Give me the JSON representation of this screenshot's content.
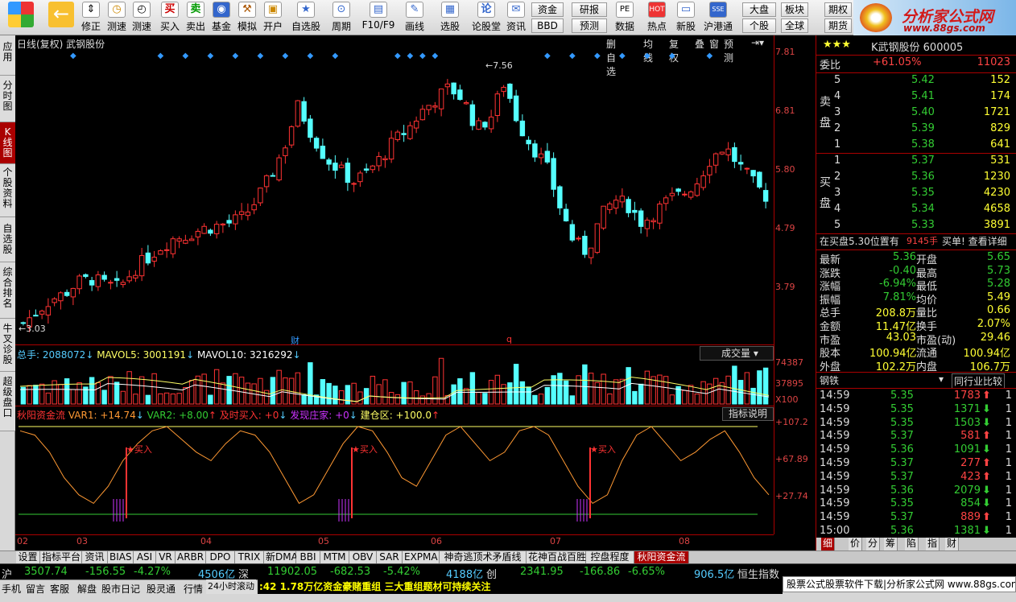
{
  "toolbar": {
    "buttons": [
      {
        "label": "",
        "icon": "windows-flag-icon"
      },
      {
        "label": "",
        "icon": "back-arrow-icon"
      },
      {
        "label": "修正",
        "icon": "up-down-icon"
      },
      {
        "label": "测速",
        "icon": "clock-icon"
      },
      {
        "label": "买入",
        "icon": "buy-icon"
      },
      {
        "label": "卖出",
        "icon": "sell-icon"
      },
      {
        "label": "基金",
        "icon": "fund-icon"
      },
      {
        "label": "模拟",
        "icon": "hammer-icon"
      },
      {
        "label": "开户",
        "icon": "lock-icon"
      },
      {
        "label": "自选股",
        "icon": "star-icon"
      },
      {
        "label": "周期",
        "icon": "period-icon"
      },
      {
        "label": "F10/F9",
        "icon": "f10-icon"
      },
      {
        "label": "画线",
        "icon": "pencil-icon"
      },
      {
        "label": "选股",
        "icon": "select-stock-icon"
      },
      {
        "label": "论股堂",
        "icon": "forum-icon"
      },
      {
        "label": "资讯",
        "icon": "news-icon"
      }
    ],
    "small_buttons": [
      "资金",
      "BBD",
      "研报",
      "预测",
      "数据",
      "热点",
      "新股",
      "沪港通",
      "大盘",
      "板块",
      "期权",
      "个股",
      "全球",
      "期货"
    ],
    "logo_title": "分析家公式网",
    "logo_url": "www.88gs.com"
  },
  "left_tabs": [
    {
      "label": "应用",
      "active": false
    },
    {
      "label": "分时图",
      "active": false
    },
    {
      "label": "K线图",
      "active": true
    },
    {
      "label": "个股资料",
      "active": false
    },
    {
      "label": "自选股",
      "active": false
    },
    {
      "label": "综合排名",
      "active": false
    },
    {
      "label": "牛叉诊股",
      "active": false
    },
    {
      "label": "超级盘口",
      "active": false
    }
  ],
  "chart_header": {
    "title": "日线(复权) 武钢股份",
    "right_buttons": [
      "删自选",
      "均线",
      "复权",
      "叠",
      "窗",
      "预测"
    ],
    "price_max_label": "←7.56",
    "price_min_label": "←3.03",
    "event_labels": [
      "财",
      "q"
    ]
  },
  "chart_data": [
    {
      "type": "candlestick",
      "title": "日线(复权) 武钢股份",
      "y_ticks": [
        "7.81",
        "6.81",
        "5.80",
        "4.79",
        "3.79"
      ],
      "ylim": [
        3.03,
        7.81
      ],
      "x_ticks": [
        "02",
        "03",
        "04",
        "05",
        "06",
        "07",
        "08"
      ],
      "high": 7.56,
      "low": 3.03
    },
    {
      "type": "bar",
      "title": "成交量",
      "legend": [
        {
          "name": "总手",
          "value": "2088072"
        },
        {
          "name": "MAVOL5",
          "value": "3001191"
        },
        {
          "name": "MAVOL10",
          "value": "3216292"
        }
      ],
      "y_ticks": [
        "74387",
        "37895"
      ],
      "unit": "X100"
    },
    {
      "type": "line",
      "title": "秋阳资金流",
      "legend": [
        {
          "name": "VAR1",
          "value": "+14.74"
        },
        {
          "name": "VAR2",
          "value": "+8.00"
        },
        {
          "name": "及时买入",
          "value": "+0"
        },
        {
          "name": "发现庄家",
          "value": "+0"
        },
        {
          "name": "建仓区",
          "value": "+100.0"
        }
      ],
      "y_ticks": [
        "+107.2",
        "+67.89",
        "+27.74"
      ],
      "annotations": [
        "★买入",
        "★买入",
        "★买入"
      ]
    }
  ],
  "indicator_button": "指标说明",
  "volume_button": "成交量",
  "quote": {
    "stars": "★★★",
    "name": "K武钢股份 600005",
    "weibi_label": "委比",
    "weibi_pct": "+61.05%",
    "weibi_val": "11023",
    "sell_label": "卖盘",
    "buy_label": "买盘",
    "sell": [
      {
        "lvl": "5",
        "price": "5.42",
        "vol": "152"
      },
      {
        "lvl": "4",
        "price": "5.41",
        "vol": "174"
      },
      {
        "lvl": "3",
        "price": "5.40",
        "vol": "1721"
      },
      {
        "lvl": "2",
        "price": "5.39",
        "vol": "829"
      },
      {
        "lvl": "1",
        "price": "5.38",
        "vol": "641"
      }
    ],
    "buy": [
      {
        "lvl": "1",
        "price": "5.37",
        "vol": "531"
      },
      {
        "lvl": "2",
        "price": "5.36",
        "vol": "1230"
      },
      {
        "lvl": "3",
        "price": "5.35",
        "vol": "4230"
      },
      {
        "lvl": "4",
        "price": "5.34",
        "vol": "4658"
      },
      {
        "lvl": "5",
        "price": "5.33",
        "vol": "3891"
      }
    ],
    "pos_note": "在买盘5.30位置有",
    "pos_vol": "9145手",
    "pos_action": "买单! 查看详细",
    "stats": [
      {
        "l1": "最新",
        "v1": "5.36",
        "l2": "开盘",
        "v2": "5.65"
      },
      {
        "l1": "涨跌",
        "v1": "-0.40",
        "l2": "最高",
        "v2": "5.73"
      },
      {
        "l1": "涨幅",
        "v1": "-6.94%",
        "l2": "最低",
        "v2": "5.28"
      },
      {
        "l1": "振幅",
        "v1": "7.81%",
        "l2": "均价",
        "v2": "5.49"
      },
      {
        "l1": "总手",
        "v1": "208.8万",
        "l2": "量比",
        "v2": "0.66"
      },
      {
        "l1": "金额",
        "v1": "11.47亿",
        "l2": "换手",
        "v2": "2.07%"
      },
      {
        "l1": "市盈",
        "v1": "43.03",
        "l2": "市盈(动)",
        "v2": "29.46"
      },
      {
        "l1": "股本",
        "v1": "100.94亿",
        "l2": "流通",
        "v2": "100.94亿"
      },
      {
        "l1": "外盘",
        "v1": "102.2万",
        "l2": "内盘",
        "v2": "106.7万"
      }
    ],
    "industry": "钢铁",
    "peer_compare": "同行业比较",
    "ticks": [
      {
        "t": "14:59",
        "p": "5.35",
        "v": "1783",
        "d": "up",
        "n": "1"
      },
      {
        "t": "14:59",
        "p": "5.35",
        "v": "1371",
        "d": "down",
        "n": "1"
      },
      {
        "t": "14:59",
        "p": "5.35",
        "v": "1503",
        "d": "down",
        "n": "1"
      },
      {
        "t": "14:59",
        "p": "5.37",
        "v": "581",
        "d": "up",
        "n": "1"
      },
      {
        "t": "14:59",
        "p": "5.36",
        "v": "1091",
        "d": "down",
        "n": "1"
      },
      {
        "t": "14:59",
        "p": "5.37",
        "v": "277",
        "d": "up",
        "n": "1"
      },
      {
        "t": "14:59",
        "p": "5.37",
        "v": "423",
        "d": "up",
        "n": "1"
      },
      {
        "t": "14:59",
        "p": "5.36",
        "v": "2079",
        "d": "down",
        "n": "1"
      },
      {
        "t": "14:59",
        "p": "5.35",
        "v": "854",
        "d": "down",
        "n": "1"
      },
      {
        "t": "14:59",
        "p": "5.37",
        "v": "889",
        "d": "up",
        "n": "1"
      },
      {
        "t": "15:00",
        "p": "5.36",
        "v": "1381",
        "d": "down",
        "n": "1"
      }
    ],
    "bottom_tabs": [
      "细",
      "价",
      "分",
      "筹",
      "陷",
      "指",
      "财"
    ]
  },
  "bottom_tabs": [
    "设置",
    "指标平台",
    "资讯",
    "BIAS",
    "ASI",
    "VR",
    "ARBR",
    "DPO",
    "TRIX",
    "新DMA",
    "BBI",
    "MTM",
    "OBV",
    "SAR",
    "EXPMA",
    "神奇逃顶术矛盾线",
    "花神百战百胜",
    "控盘程度",
    "秋阳资金流"
  ],
  "status1": {
    "sh_label": "沪",
    "sh_index": "3507.74",
    "sh_chg": "-156.55",
    "sh_pct": "-4.27%",
    "sh_amt": "4506亿",
    "sz_label": "深",
    "sz_index": "11902.05",
    "sz_chg": "-682.53",
    "sz_pct": "-5.42%",
    "sz_amt": "4188亿",
    "cy_label": "创",
    "cy_index": "2341.95",
    "cy_chg": "-166.86",
    "cy_pct": "-6.65%",
    "hs_amt": "906.5亿",
    "hs_label": "恒生指数"
  },
  "status2": {
    "items": [
      "手机",
      "留言",
      "客服",
      "解盘",
      "股市日记",
      "股灵通",
      "行情",
      "24小时滚动"
    ],
    "ticker": ":42 1.78万亿资金豪赌重组 三大重组题材可持续关注",
    "ad": "股票公式股票软件下载|分析家公式网 www.88gs.com"
  }
}
